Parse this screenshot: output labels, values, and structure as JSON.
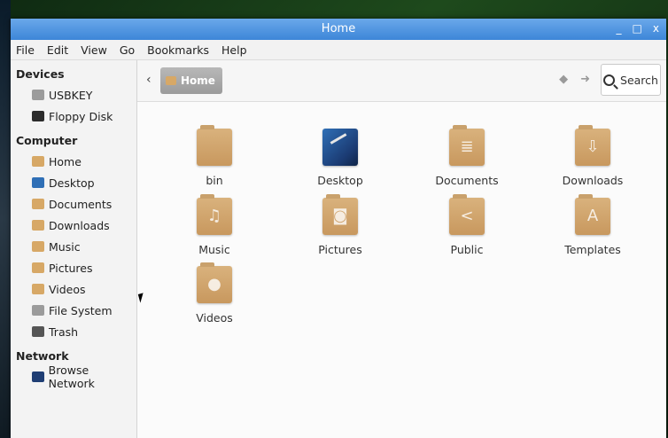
{
  "window": {
    "title": "Home"
  },
  "window_controls": {
    "minimize": "_",
    "maximize": "□",
    "close": "x"
  },
  "menubar": [
    "File",
    "Edit",
    "View",
    "Go",
    "Bookmarks",
    "Help"
  ],
  "sidebar": {
    "sections": [
      {
        "heading": "Devices",
        "items": [
          {
            "label": "USBKEY",
            "icon": "drive-icon",
            "color": "#9b9b9b"
          },
          {
            "label": "Floppy Disk",
            "icon": "floppy-icon",
            "color": "#2b2b2b"
          }
        ]
      },
      {
        "heading": "Computer",
        "items": [
          {
            "label": "Home",
            "icon": "home-folder-icon",
            "color": "#d7a866"
          },
          {
            "label": "Desktop",
            "icon": "desktop-icon",
            "color": "#2f6fb6"
          },
          {
            "label": "Documents",
            "icon": "documents-folder-icon",
            "color": "#d7a866"
          },
          {
            "label": "Downloads",
            "icon": "downloads-folder-icon",
            "color": "#d7a866"
          },
          {
            "label": "Music",
            "icon": "music-folder-icon",
            "color": "#d7a866"
          },
          {
            "label": "Pictures",
            "icon": "pictures-folder-icon",
            "color": "#d7a866"
          },
          {
            "label": "Videos",
            "icon": "videos-folder-icon",
            "color": "#d7a866"
          },
          {
            "label": "File System",
            "icon": "filesystem-icon",
            "color": "#9b9b9b"
          },
          {
            "label": "Trash",
            "icon": "trash-icon",
            "color": "#555555"
          }
        ]
      },
      {
        "heading": "Network",
        "items": [
          {
            "label": "Browse Network",
            "icon": "network-icon",
            "color": "#1f3e74"
          }
        ]
      }
    ]
  },
  "toolbar": {
    "breadcrumb": "Home",
    "search_label": "Search"
  },
  "files": [
    {
      "name": "bin",
      "icon": "folder-icon",
      "glyph": ""
    },
    {
      "name": "Desktop",
      "icon": "desktop-icon",
      "glyph": ""
    },
    {
      "name": "Documents",
      "icon": "documents-folder-icon",
      "glyph": "≣"
    },
    {
      "name": "Downloads",
      "icon": "downloads-folder-icon",
      "glyph": "⇩"
    },
    {
      "name": "Music",
      "icon": "music-folder-icon",
      "glyph": "♫"
    },
    {
      "name": "Pictures",
      "icon": "pictures-folder-icon",
      "glyph": "◙"
    },
    {
      "name": "Public",
      "icon": "public-folder-icon",
      "glyph": "<"
    },
    {
      "name": "Templates",
      "icon": "templates-folder-icon",
      "glyph": "A"
    },
    {
      "name": "Videos",
      "icon": "videos-folder-icon",
      "glyph": "●"
    }
  ]
}
